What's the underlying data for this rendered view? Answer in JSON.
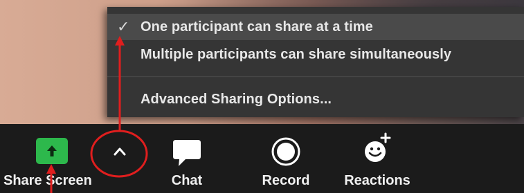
{
  "menu": {
    "items": [
      {
        "label": "One participant can share at a time",
        "checked": true
      },
      {
        "label": "Multiple participants can share simultaneously",
        "checked": false
      }
    ],
    "advanced_label": "Advanced Sharing Options...",
    "check_glyph": "✓"
  },
  "toolbar": {
    "share_screen": {
      "label": "Share Screen",
      "icon": "share-arrow-icon",
      "accent": "#2db84c"
    },
    "options_caret": {
      "icon": "chevron-up-icon"
    },
    "chat": {
      "label": "Chat",
      "icon": "chat-bubble-icon"
    },
    "record": {
      "label": "Record",
      "icon": "record-icon"
    },
    "reactions": {
      "label": "Reactions",
      "icon": "emoji-add-icon"
    }
  },
  "annotation": {
    "color": "#e01e1e"
  }
}
